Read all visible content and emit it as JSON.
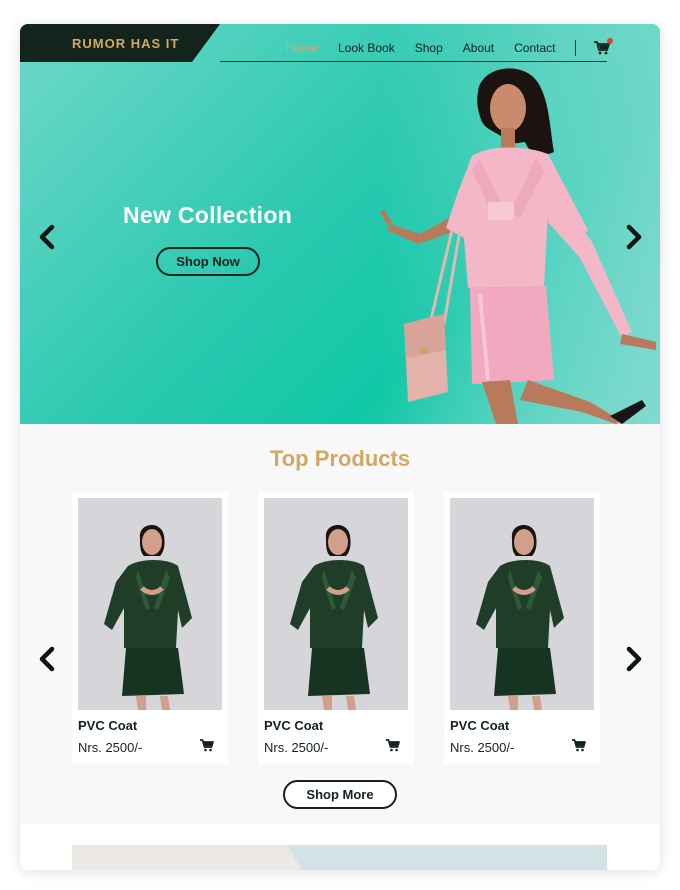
{
  "brand": {
    "name": "RUMOR HAS IT"
  },
  "nav": {
    "items": [
      {
        "label": "Home",
        "active": true
      },
      {
        "label": "Look Book",
        "active": false
      },
      {
        "label": "Shop",
        "active": false
      },
      {
        "label": "About",
        "active": false
      },
      {
        "label": "Contact",
        "active": false
      }
    ],
    "cart_icon": "cart-icon"
  },
  "hero": {
    "title": "New Collection",
    "cta_label": "Shop Now",
    "prev_icon": "chevron-left-icon",
    "next_icon": "chevron-right-icon"
  },
  "top_products": {
    "title": "Top Products",
    "products": [
      {
        "name": "PVC Coat",
        "price": "Nrs. 2500/-"
      },
      {
        "name": "PVC Coat",
        "price": "Nrs. 2500/-"
      },
      {
        "name": "PVC Coat",
        "price": "Nrs. 2500/-"
      }
    ],
    "more_label": "Shop More"
  },
  "colors": {
    "brand_dark": "#12241c",
    "accent_gold": "#d1a861",
    "hero_teal": "#10c7a6",
    "cart_badge": "#e03b3b"
  }
}
